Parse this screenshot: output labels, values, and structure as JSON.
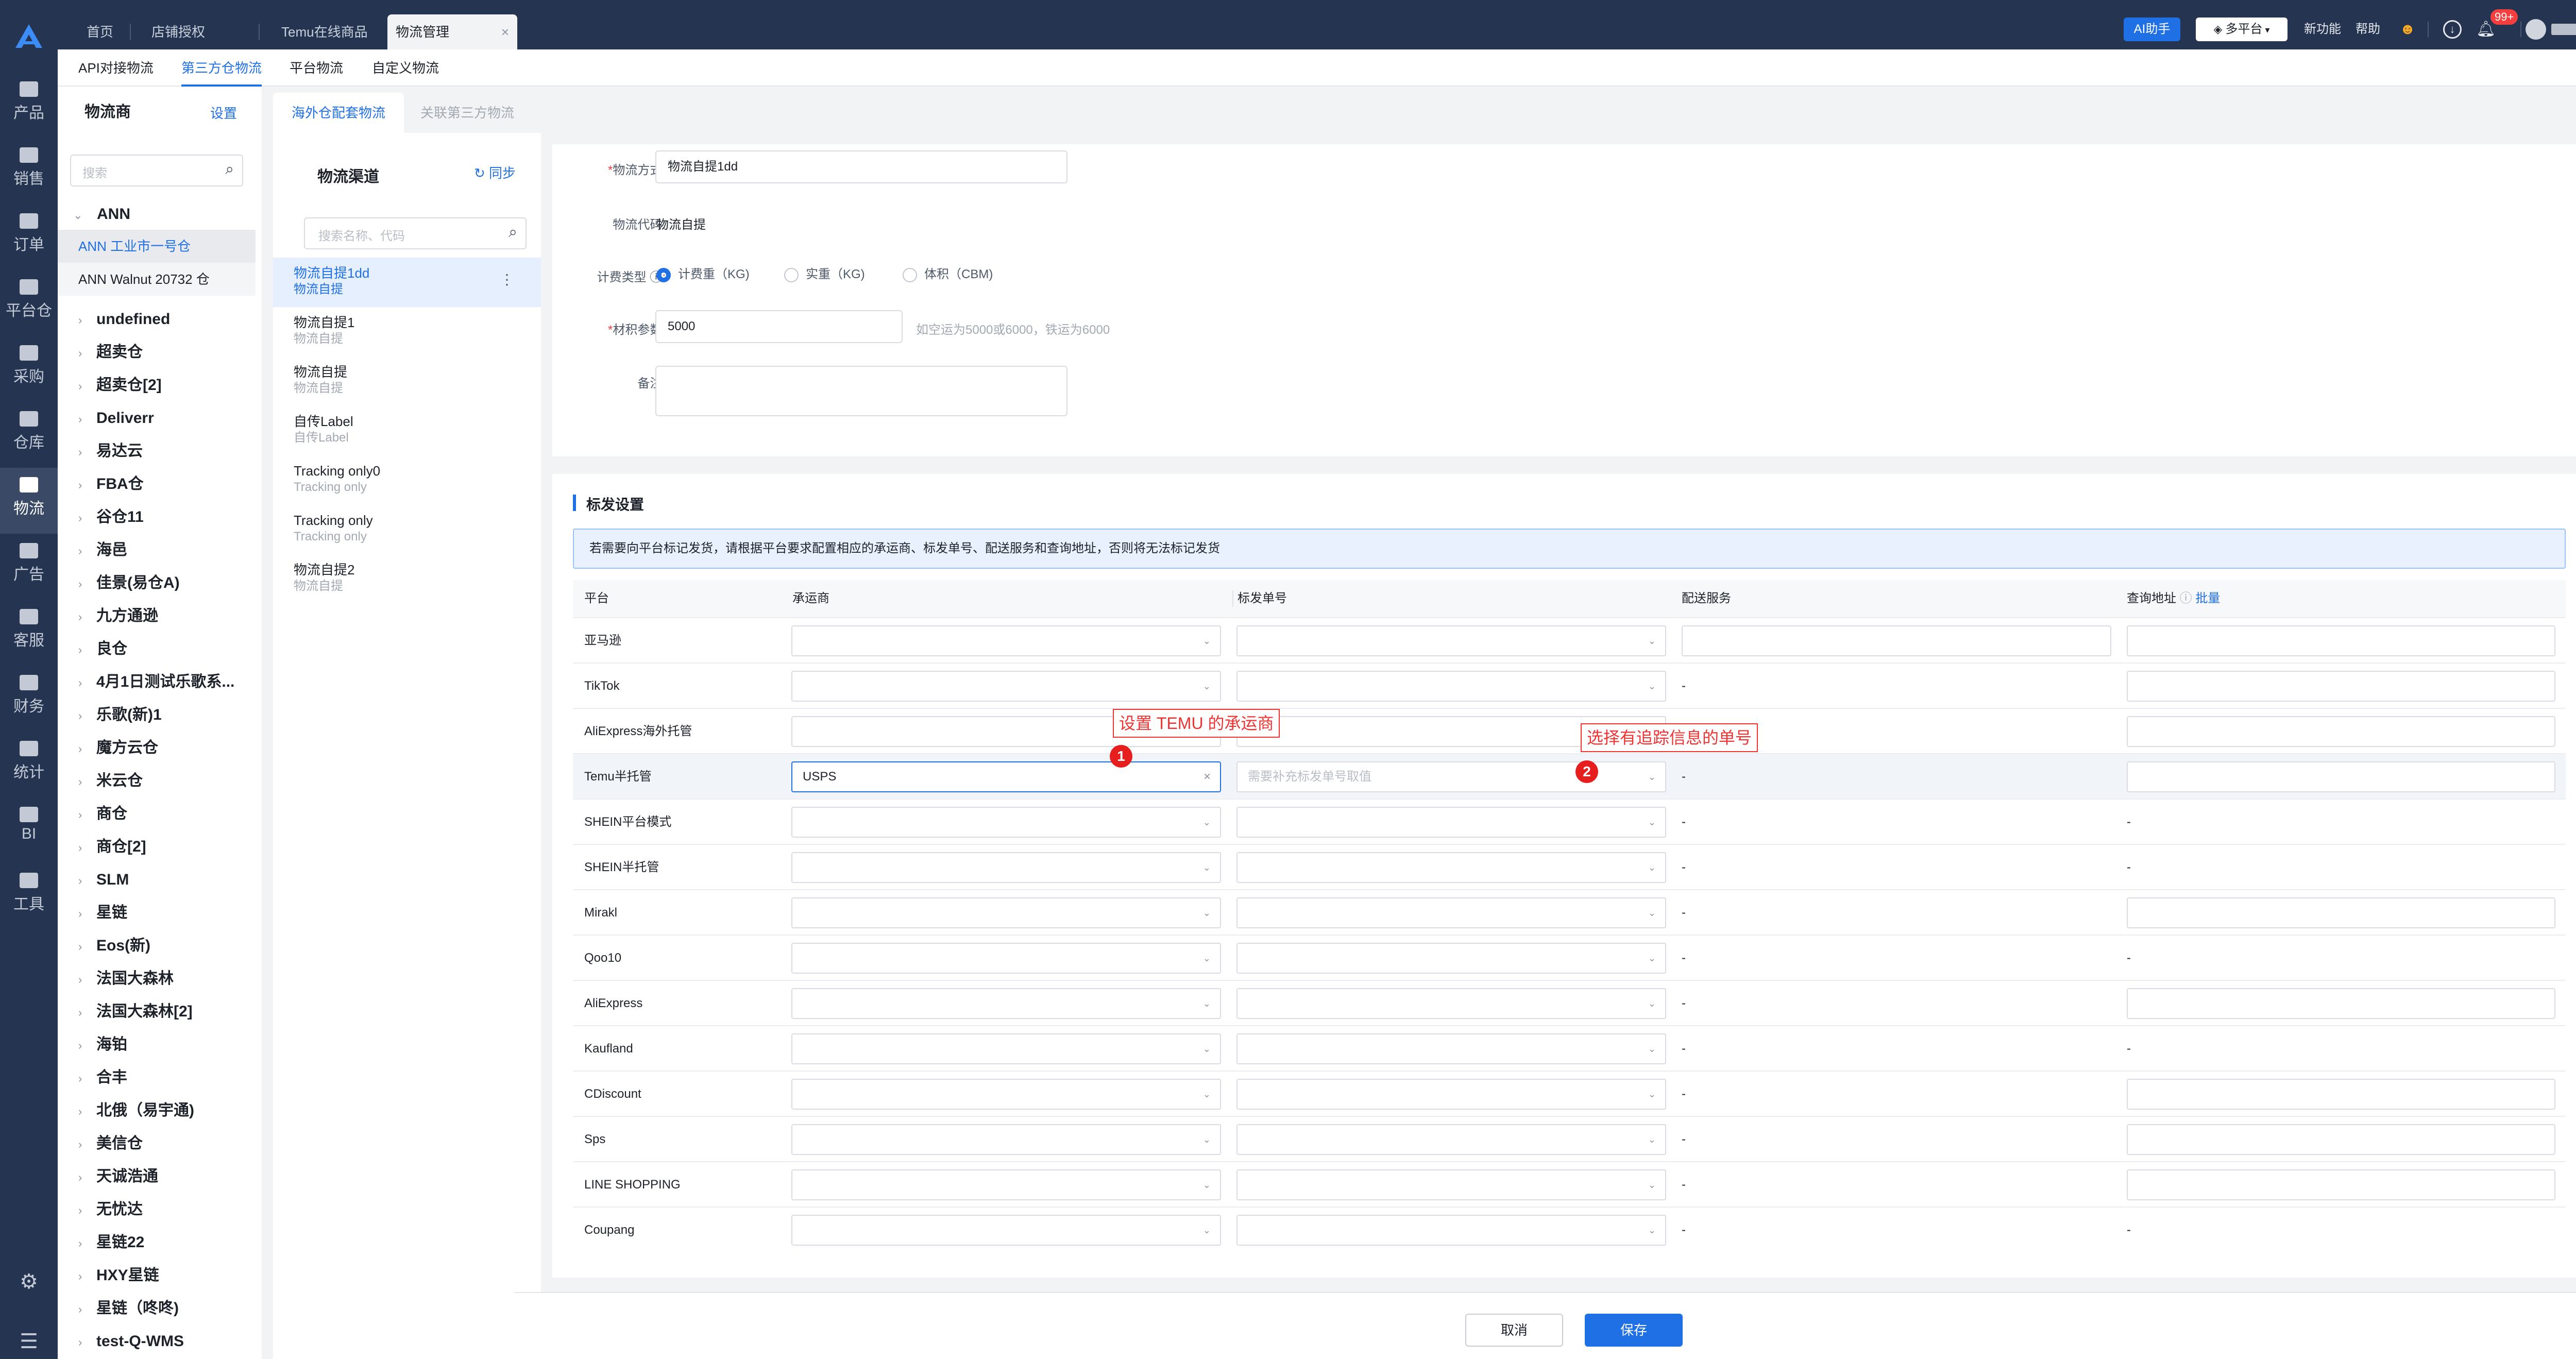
{
  "topbar": {
    "tabs": [
      "首页",
      "店铺授权",
      "Temu在线商品",
      "物流管理"
    ],
    "ai_label": "AI助手",
    "platform_label": "多平台",
    "new_feature": "新功能",
    "help": "帮助",
    "notification_badge": "99+"
  },
  "leftnav": {
    "items": [
      "产品",
      "销售",
      "订单",
      "平台仓",
      "采购",
      "仓库",
      "物流",
      "广告",
      "客服",
      "财务",
      "统计",
      "BI",
      "工具"
    ]
  },
  "subtabs": [
    "API对接物流",
    "第三方仓物流",
    "平台物流",
    "自定义物流"
  ],
  "provider": {
    "title": "物流商",
    "settings": "设置",
    "search_placeholder": "搜索",
    "group_open": "ANN",
    "sub_items": [
      "ANN 工业市一号仓",
      "ANN Walnut 20732 仓"
    ],
    "items": [
      "undefined",
      "超卖仓",
      "超卖仓[2]",
      "Deliverr",
      "易达云",
      "FBA仓",
      "谷仓11",
      "海邑",
      "佳景(易仓A)",
      "九方通逊",
      "良仓",
      "4月1日测试乐歌系...",
      "乐歌(新)1",
      "魔方云仓",
      "米云仓",
      "商仓",
      "商仓[2]",
      "SLM",
      "星链",
      "Eos(新)",
      "法国大森林",
      "法国大森林[2]",
      "海铂",
      "合丰",
      "北俄（易宇通)",
      "美信仓",
      "天诚浩通",
      "无忧达",
      "星链22",
      "HXY星链",
      "星链（咚咚)",
      "test-Q-WMS"
    ]
  },
  "main_tabs": [
    "海外仓配套物流",
    "关联第三方物流"
  ],
  "channel": {
    "title": "物流渠道",
    "sync": "同步",
    "search_placeholder": "搜索名称、代码",
    "items": [
      {
        "name": "物流自提1dd",
        "code": "物流自提"
      },
      {
        "name": "物流自提1",
        "code": "物流自提"
      },
      {
        "name": "物流自提",
        "code": "物流自提"
      },
      {
        "name": "自传Label",
        "code": "自传Label"
      },
      {
        "name": "Tracking only0",
        "code": "Tracking only"
      },
      {
        "name": "Tracking only",
        "code": "Tracking only"
      },
      {
        "name": "物流自提2",
        "code": "物流自提"
      }
    ]
  },
  "form": {
    "method_label": "物流方式",
    "method_value": "物流自提1dd",
    "code_label": "物流代码",
    "code_value": "物流自提",
    "billing_label": "计费类型",
    "billing_options": [
      "计费重（KG)",
      "实重（KG)",
      "体积（CBM)"
    ],
    "volume_label": "材积参数",
    "volume_value": "5000",
    "volume_hint": "如空运为5000或6000，铁运为6000",
    "remark_label": "备注"
  },
  "shipping": {
    "title": "标发设置",
    "notice": "若需要向平台标记发货，请根据平台要求配置相应的承运商、标发单号、配送服务和查询地址，否则将无法标记发货",
    "headers": {
      "platform": "平台",
      "carrier": "承运商",
      "tracking": "标发单号",
      "delivery": "配送服务",
      "query": "查询地址",
      "batch": "批量"
    },
    "rows": [
      {
        "platform": "亚马逊",
        "carrier": "",
        "delivery": "input",
        "query": "input"
      },
      {
        "platform": "TikTok",
        "carrier": "",
        "delivery": "-",
        "query": "input"
      },
      {
        "platform": "AliExpress海外托管",
        "carrier": "",
        "delivery": "-",
        "query": "input"
      },
      {
        "platform": "Temu半托管",
        "carrier": "USPS",
        "delivery": "-",
        "query": "input"
      },
      {
        "platform": "SHEIN平台模式",
        "carrier": "",
        "delivery": "-",
        "query": "-"
      },
      {
        "platform": "SHEIN半托管",
        "carrier": "",
        "delivery": "-",
        "query": "-"
      },
      {
        "platform": "Mirakl",
        "carrier": "",
        "delivery": "-",
        "query": "input"
      },
      {
        "platform": "Qoo10",
        "carrier": "",
        "delivery": "-",
        "query": "-"
      },
      {
        "platform": "AliExpress",
        "carrier": "",
        "delivery": "-",
        "query": "input"
      },
      {
        "platform": "Kaufland",
        "carrier": "",
        "delivery": "-",
        "query": "-"
      },
      {
        "platform": "CDiscount",
        "carrier": "",
        "delivery": "-",
        "query": "input"
      },
      {
        "platform": "Sps",
        "carrier": "",
        "delivery": "-",
        "query": "input"
      },
      {
        "platform": "LINE SHOPPING",
        "carrier": "",
        "delivery": "-",
        "query": "input"
      },
      {
        "platform": "Coupang",
        "carrier": "",
        "delivery": "-",
        "query": "-"
      }
    ],
    "tracking_placeholder": "需要补充标发单号取值",
    "callout1": "设置 TEMU 的承运商",
    "callout2": "选择有追踪信息的单号",
    "badge1": "1",
    "badge2": "2"
  },
  "footer": {
    "cancel": "取消",
    "save": "保存"
  },
  "colors": {
    "primary": "#1f6fe5",
    "nav_bg": "#253551",
    "annotation": "#e61e1e"
  }
}
